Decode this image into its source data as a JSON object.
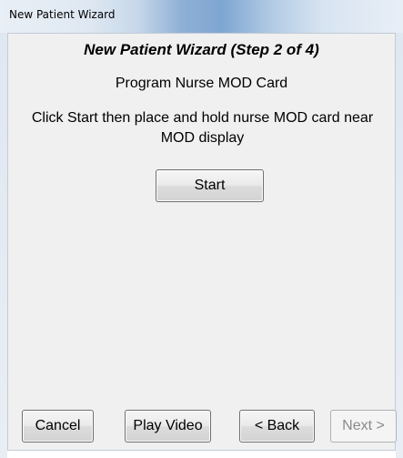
{
  "window": {
    "title": "New Patient Wizard"
  },
  "wizard": {
    "title": "New Patient Wizard (Step 2 of 4)",
    "step_heading": "Program Nurse MOD Card",
    "instruction": "Click Start then place and hold nurse MOD card near MOD display",
    "start_label": "Start"
  },
  "footer": {
    "cancel_label": "Cancel",
    "play_video_label": "Play Video",
    "back_label": "< Back",
    "next_label": "Next >",
    "next_enabled": false
  },
  "colors": {
    "client_background": "#f0f0f0",
    "disabled_text": "#8a8a8a"
  }
}
